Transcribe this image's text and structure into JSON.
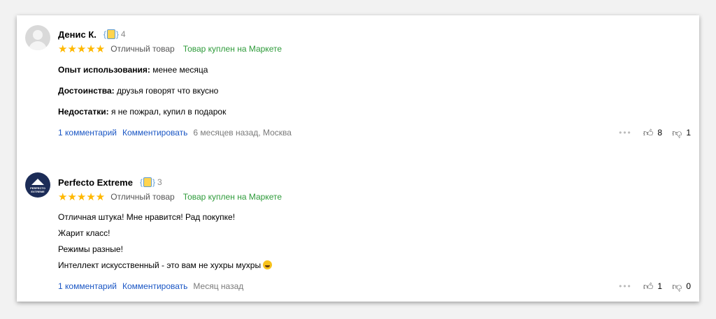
{
  "reviews": [
    {
      "author": "Денис К.",
      "level": "4",
      "stars": "★★★★★",
      "rating_label": "Отличный товар",
      "bought": "Товар куплен на Маркете",
      "experience_label": "Опыт использования:",
      "experience_value": "менее месяца",
      "pros_label": "Достоинства:",
      "pros_value": "друзья говорят что вкусно",
      "cons_label": "Недостатки:",
      "cons_value": "я не пожрал, купил в подарок",
      "comments_link": "1 комментарий",
      "comment_action": "Комментировать",
      "meta": "6 месяцев назад, Москва",
      "likes": "8",
      "dislikes": "1"
    },
    {
      "author": "Perfecto Extreme",
      "level": "3",
      "stars": "★★★★★",
      "rating_label": "Отличный товар",
      "bought": "Товар куплен на Маркете",
      "text_lines": [
        "Отличная штука! Мне нравится! Рад покупке!",
        "Жарит класс!",
        "Режимы разные!",
        "Интеллект искусственный - это вам не хухры мухры"
      ],
      "avatar_text": "PERFECTO EXTREME",
      "comments_link": "1 комментарий",
      "comment_action": "Комментировать",
      "meta": "Месяц назад",
      "likes": "1",
      "dislikes": "0"
    }
  ],
  "icons": {
    "more": "more-dots-icon",
    "like": "thumb-up-icon",
    "dislike": "thumb-down-icon",
    "emoji": "laughing-emoji-icon"
  },
  "colors": {
    "link": "#1a56c4",
    "bought": "#2e9b3a",
    "stars": "#ffb800"
  }
}
